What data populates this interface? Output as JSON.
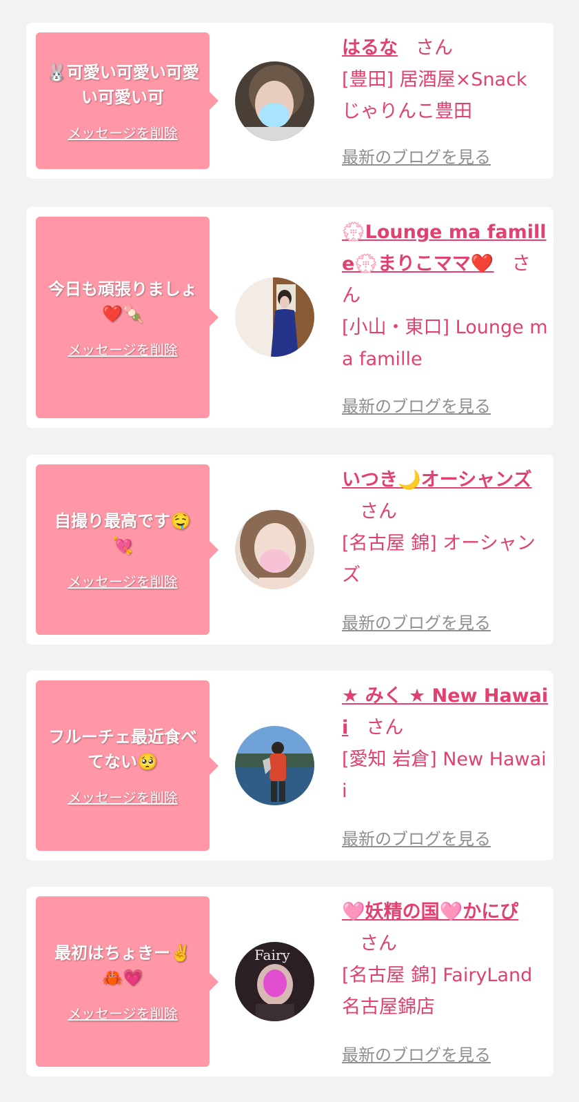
{
  "labels": {
    "delete_message": "メッセージを削除",
    "view_blog": "最新のブログを見る",
    "san": "さん"
  },
  "colors": {
    "page_bg": "#f2f2f2",
    "bubble_bg": "#ff97a7",
    "accent": "#e0416f",
    "link_gray": "#8f8f8f"
  },
  "entries": [
    {
      "message": "🐰可愛い可愛い可愛い可愛い可",
      "name": "はるな",
      "shop": "[豊田] 居酒屋×Snack じゃりんこ豊田",
      "avatar": "avatar-photo"
    },
    {
      "message": "今日も頑張りましょ❤️🍡",
      "name": "💮Lounge ma famille💮まりこママ❤️",
      "shop": "[小山・東口] Lounge ma famille",
      "avatar": "avatar-photo"
    },
    {
      "message": "自撮り最高です🤤💘",
      "name": "いつき🌙オーシャンズ",
      "shop": "[名古屋 錦] オーシャンズ",
      "avatar": "avatar-photo"
    },
    {
      "message": "フルーチェ最近食べてない🥺",
      "name": "★ みく ★ New Hawaii",
      "shop": "[愛知 岩倉] New Hawaii",
      "avatar": "avatar-photo"
    },
    {
      "message": "最初はちょきー✌️🦀💗",
      "name": "🩷妖精の国🩷かにぴ",
      "shop": "[名古屋 錦] FairyLand 名古屋錦店",
      "avatar_text": "Fairy",
      "avatar": "avatar-photo"
    }
  ]
}
